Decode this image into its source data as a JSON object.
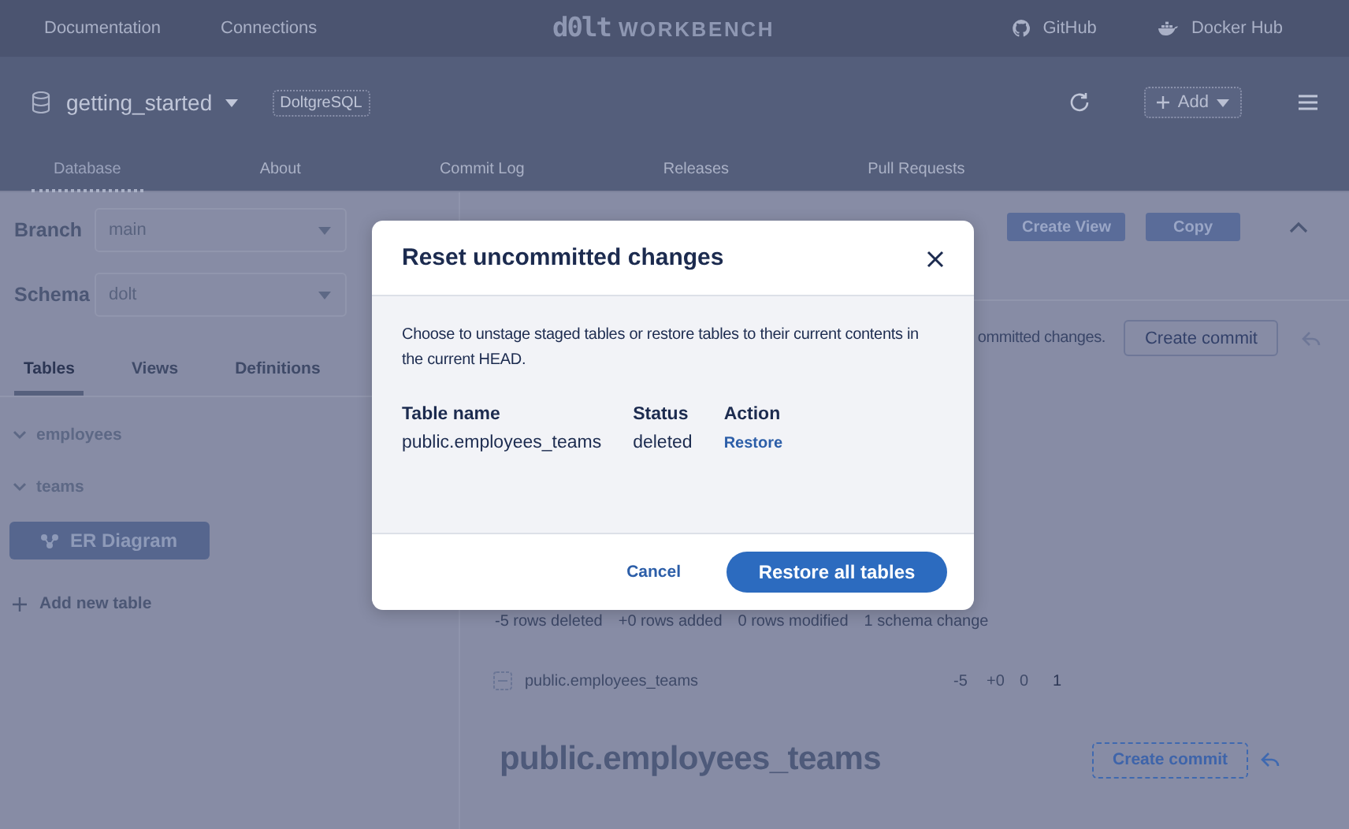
{
  "top_nav": {
    "links": [
      "Documentation",
      "Connections"
    ],
    "logo": {
      "mark": "d0lt",
      "word": "WORKBENCH"
    },
    "external_links": [
      {
        "label": "GitHub",
        "kind": "github"
      },
      {
        "label": "Docker Hub",
        "kind": "docker"
      }
    ]
  },
  "database_header": {
    "name": "getting_started",
    "badge": "DoltgreSQL",
    "add_button": "Add",
    "tabs": [
      {
        "label": "Database",
        "selected": true
      },
      {
        "label": "About",
        "selected": false
      },
      {
        "label": "Commit Log",
        "selected": false
      },
      {
        "label": "Releases",
        "selected": false
      },
      {
        "label": "Pull Requests",
        "selected": false
      }
    ]
  },
  "sidebar": {
    "selects": [
      {
        "label": "Branch",
        "value": "main"
      },
      {
        "label": "Schema",
        "value": "dolt"
      }
    ],
    "tabs": [
      {
        "label": "Tables",
        "selected": true
      },
      {
        "label": "Views",
        "selected": false
      },
      {
        "label": "Definitions",
        "selected": false
      }
    ],
    "tables": [
      "employees",
      "teams"
    ],
    "er_button": "ER Diagram",
    "add_table": "Add new table"
  },
  "main": {
    "buttons": [
      "Create View",
      "Copy"
    ],
    "status_text": "ommitted changes.",
    "commit_button": "Create commit",
    "summary": [
      "-5 rows deleted",
      "+0 rows added",
      "0 rows modified",
      "1 schema change"
    ],
    "diff_rows": [
      {
        "table": "public.employees_teams",
        "deleted": "-5",
        "added": "+0",
        "modified": "0",
        "schema": "1"
      }
    ],
    "heading": "public.employees_teams",
    "heading_button": "Create commit"
  },
  "modal": {
    "title": "Reset uncommitted changes",
    "text": "Choose to unstage staged tables or restore tables to their current contents in the current HEAD.",
    "columns": [
      "Table name",
      "Status",
      "Action"
    ],
    "rows": [
      {
        "table": "public.employees_teams",
        "status": "deleted",
        "action": "Restore"
      }
    ],
    "cancel": "Cancel",
    "confirm": "Restore all tables"
  }
}
